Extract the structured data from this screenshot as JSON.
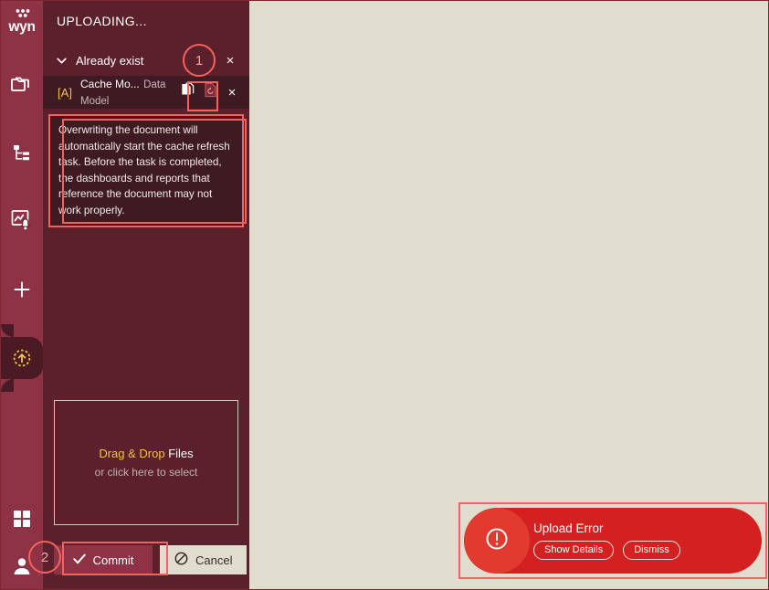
{
  "app": {
    "logo_text": "wyn",
    "colors": {
      "rail": "#8E3246",
      "panel": "#5C202C",
      "row": "#3E1B22",
      "canvas": "#E0DCCE",
      "accent_gold": "#F2C14B",
      "annotation": "#F5615C",
      "error_toast": "#D42020"
    }
  },
  "rail": {
    "items": [
      {
        "icon": "documents-folder-icon",
        "label": "Documents"
      },
      {
        "icon": "hierarchy-tree-icon",
        "label": "Categories"
      },
      {
        "icon": "chart-alert-icon",
        "label": "Monitoring"
      },
      {
        "icon": "plus-icon",
        "label": "Create"
      },
      {
        "icon": "upload-circle-icon",
        "label": "Upload",
        "active": true
      },
      {
        "icon": "grid-apps-icon",
        "label": "Apps"
      },
      {
        "icon": "user-avatar-icon",
        "label": "Account"
      }
    ]
  },
  "panel": {
    "title": "UPLOADING...",
    "group": {
      "chevron": "chevron-down-icon",
      "label": "Already exist",
      "close_label": "×"
    },
    "file": {
      "type_icon": "[A]",
      "name": "Cache Mo...",
      "subtitle": "Data Model",
      "actions": {
        "keep_both": "copy-document-icon",
        "overwrite": "overwrite-document-icon",
        "remove": "×"
      }
    },
    "warning": "Overwriting the document will automatically start the cache refresh task. Before the task is completed, the dashboards and reports that reference the document may not work properly.",
    "dropzone": {
      "highlight": "Drag & Drop",
      "rest": " Files",
      "hint": "or click here to select"
    },
    "buttons": {
      "commit": "Commit",
      "commit_icon": "check-icon",
      "cancel": "Cancel",
      "cancel_icon": "no-entry-icon"
    }
  },
  "toast": {
    "icon": "error-exclamation-icon",
    "title": "Upload Error",
    "show_details": "Show Details",
    "dismiss": "Dismiss"
  },
  "annotations": {
    "one": "1",
    "two": "2"
  }
}
